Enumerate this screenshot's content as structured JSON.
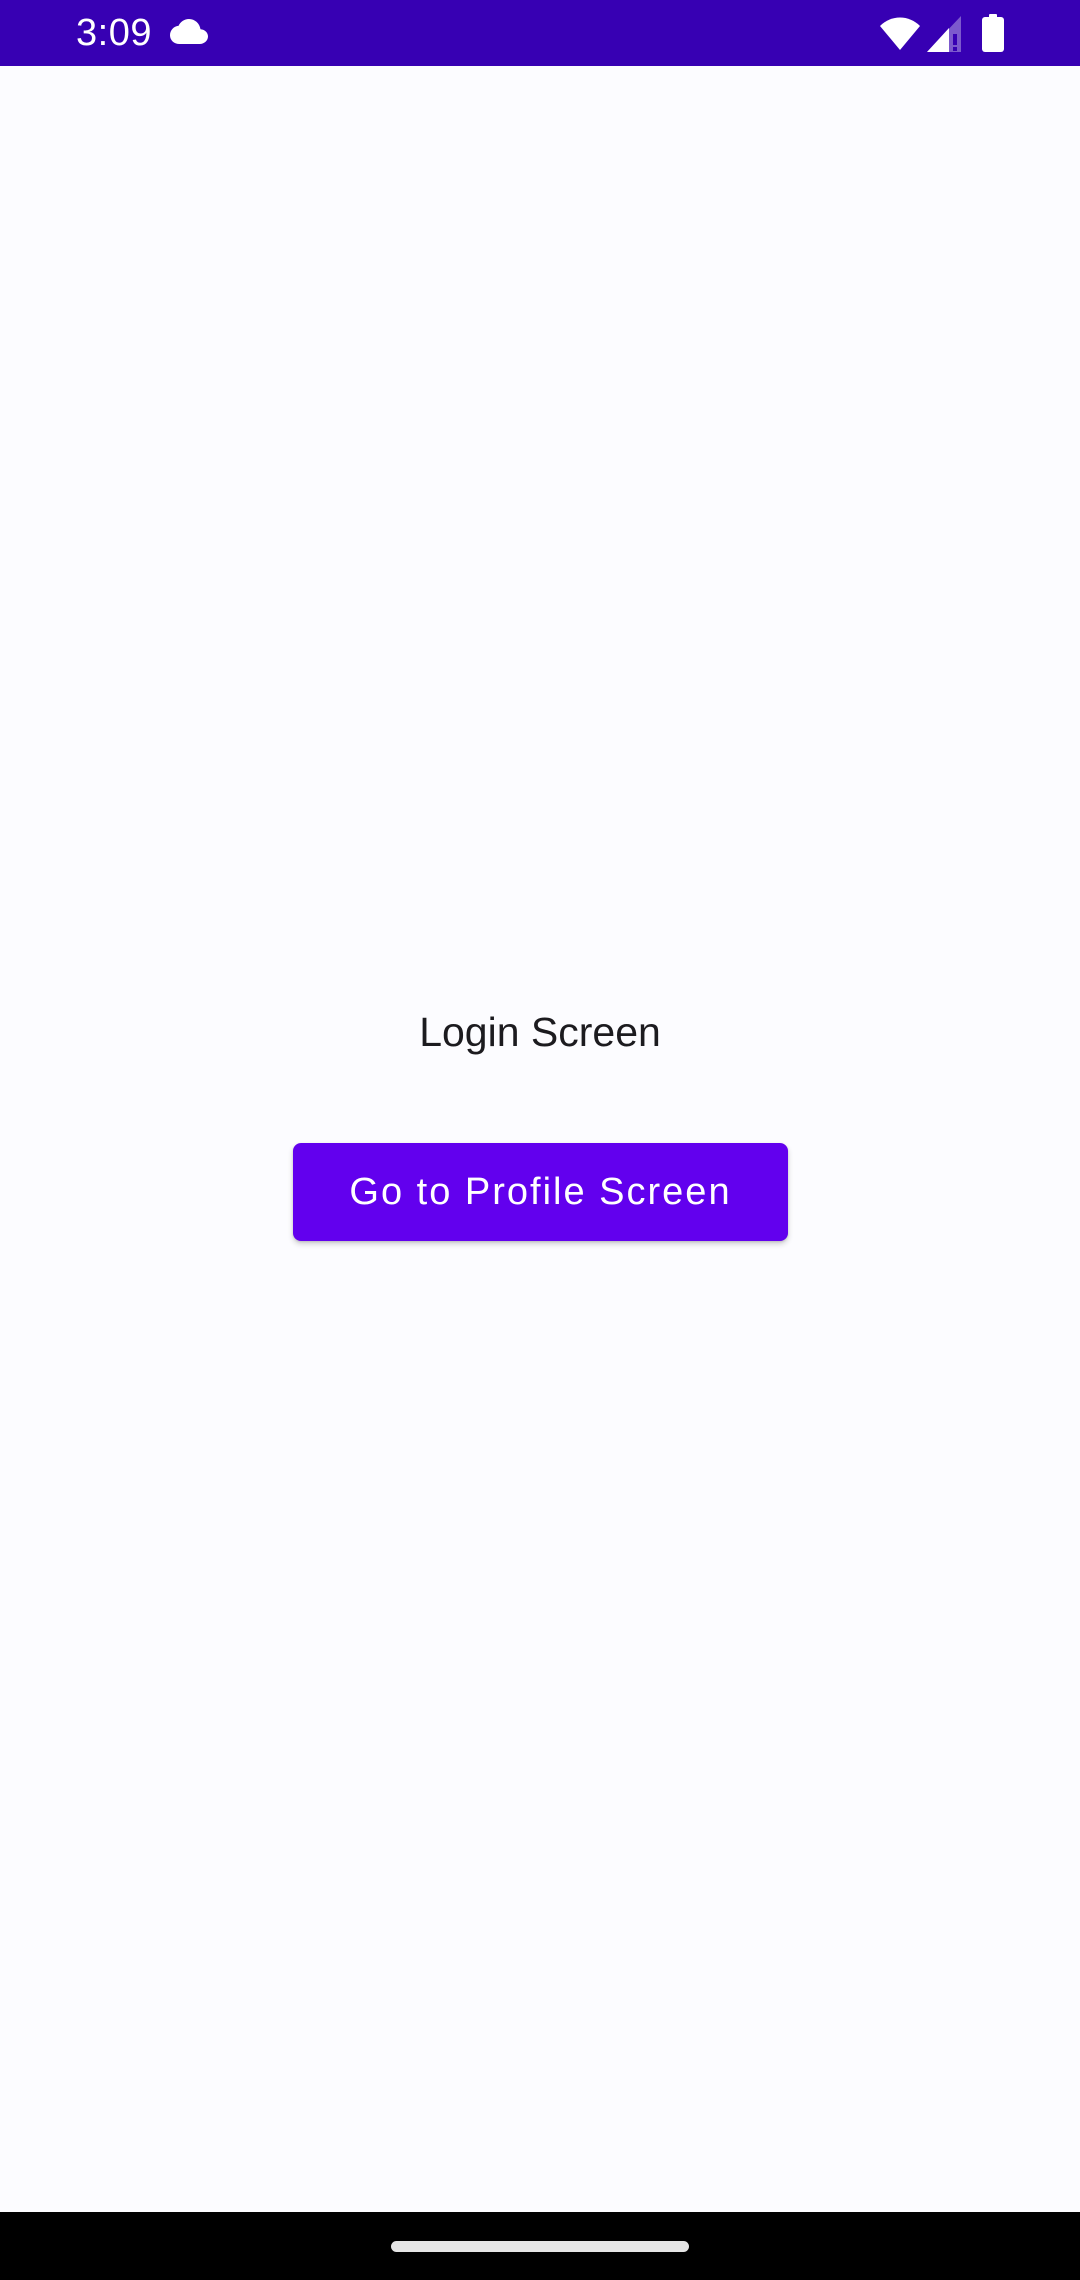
{
  "status_bar": {
    "time": "3:09",
    "background_color": "#3700b3",
    "icons": [
      "cloud-icon",
      "wifi-icon",
      "signal-icon",
      "battery-icon"
    ]
  },
  "main": {
    "title": "Login Screen",
    "button_label": "Go to Profile Screen",
    "button_color": "#6200ee",
    "background_color": "#fcfcff"
  },
  "nav_bar": {
    "background_color": "#000000",
    "handle": "home-handle"
  }
}
